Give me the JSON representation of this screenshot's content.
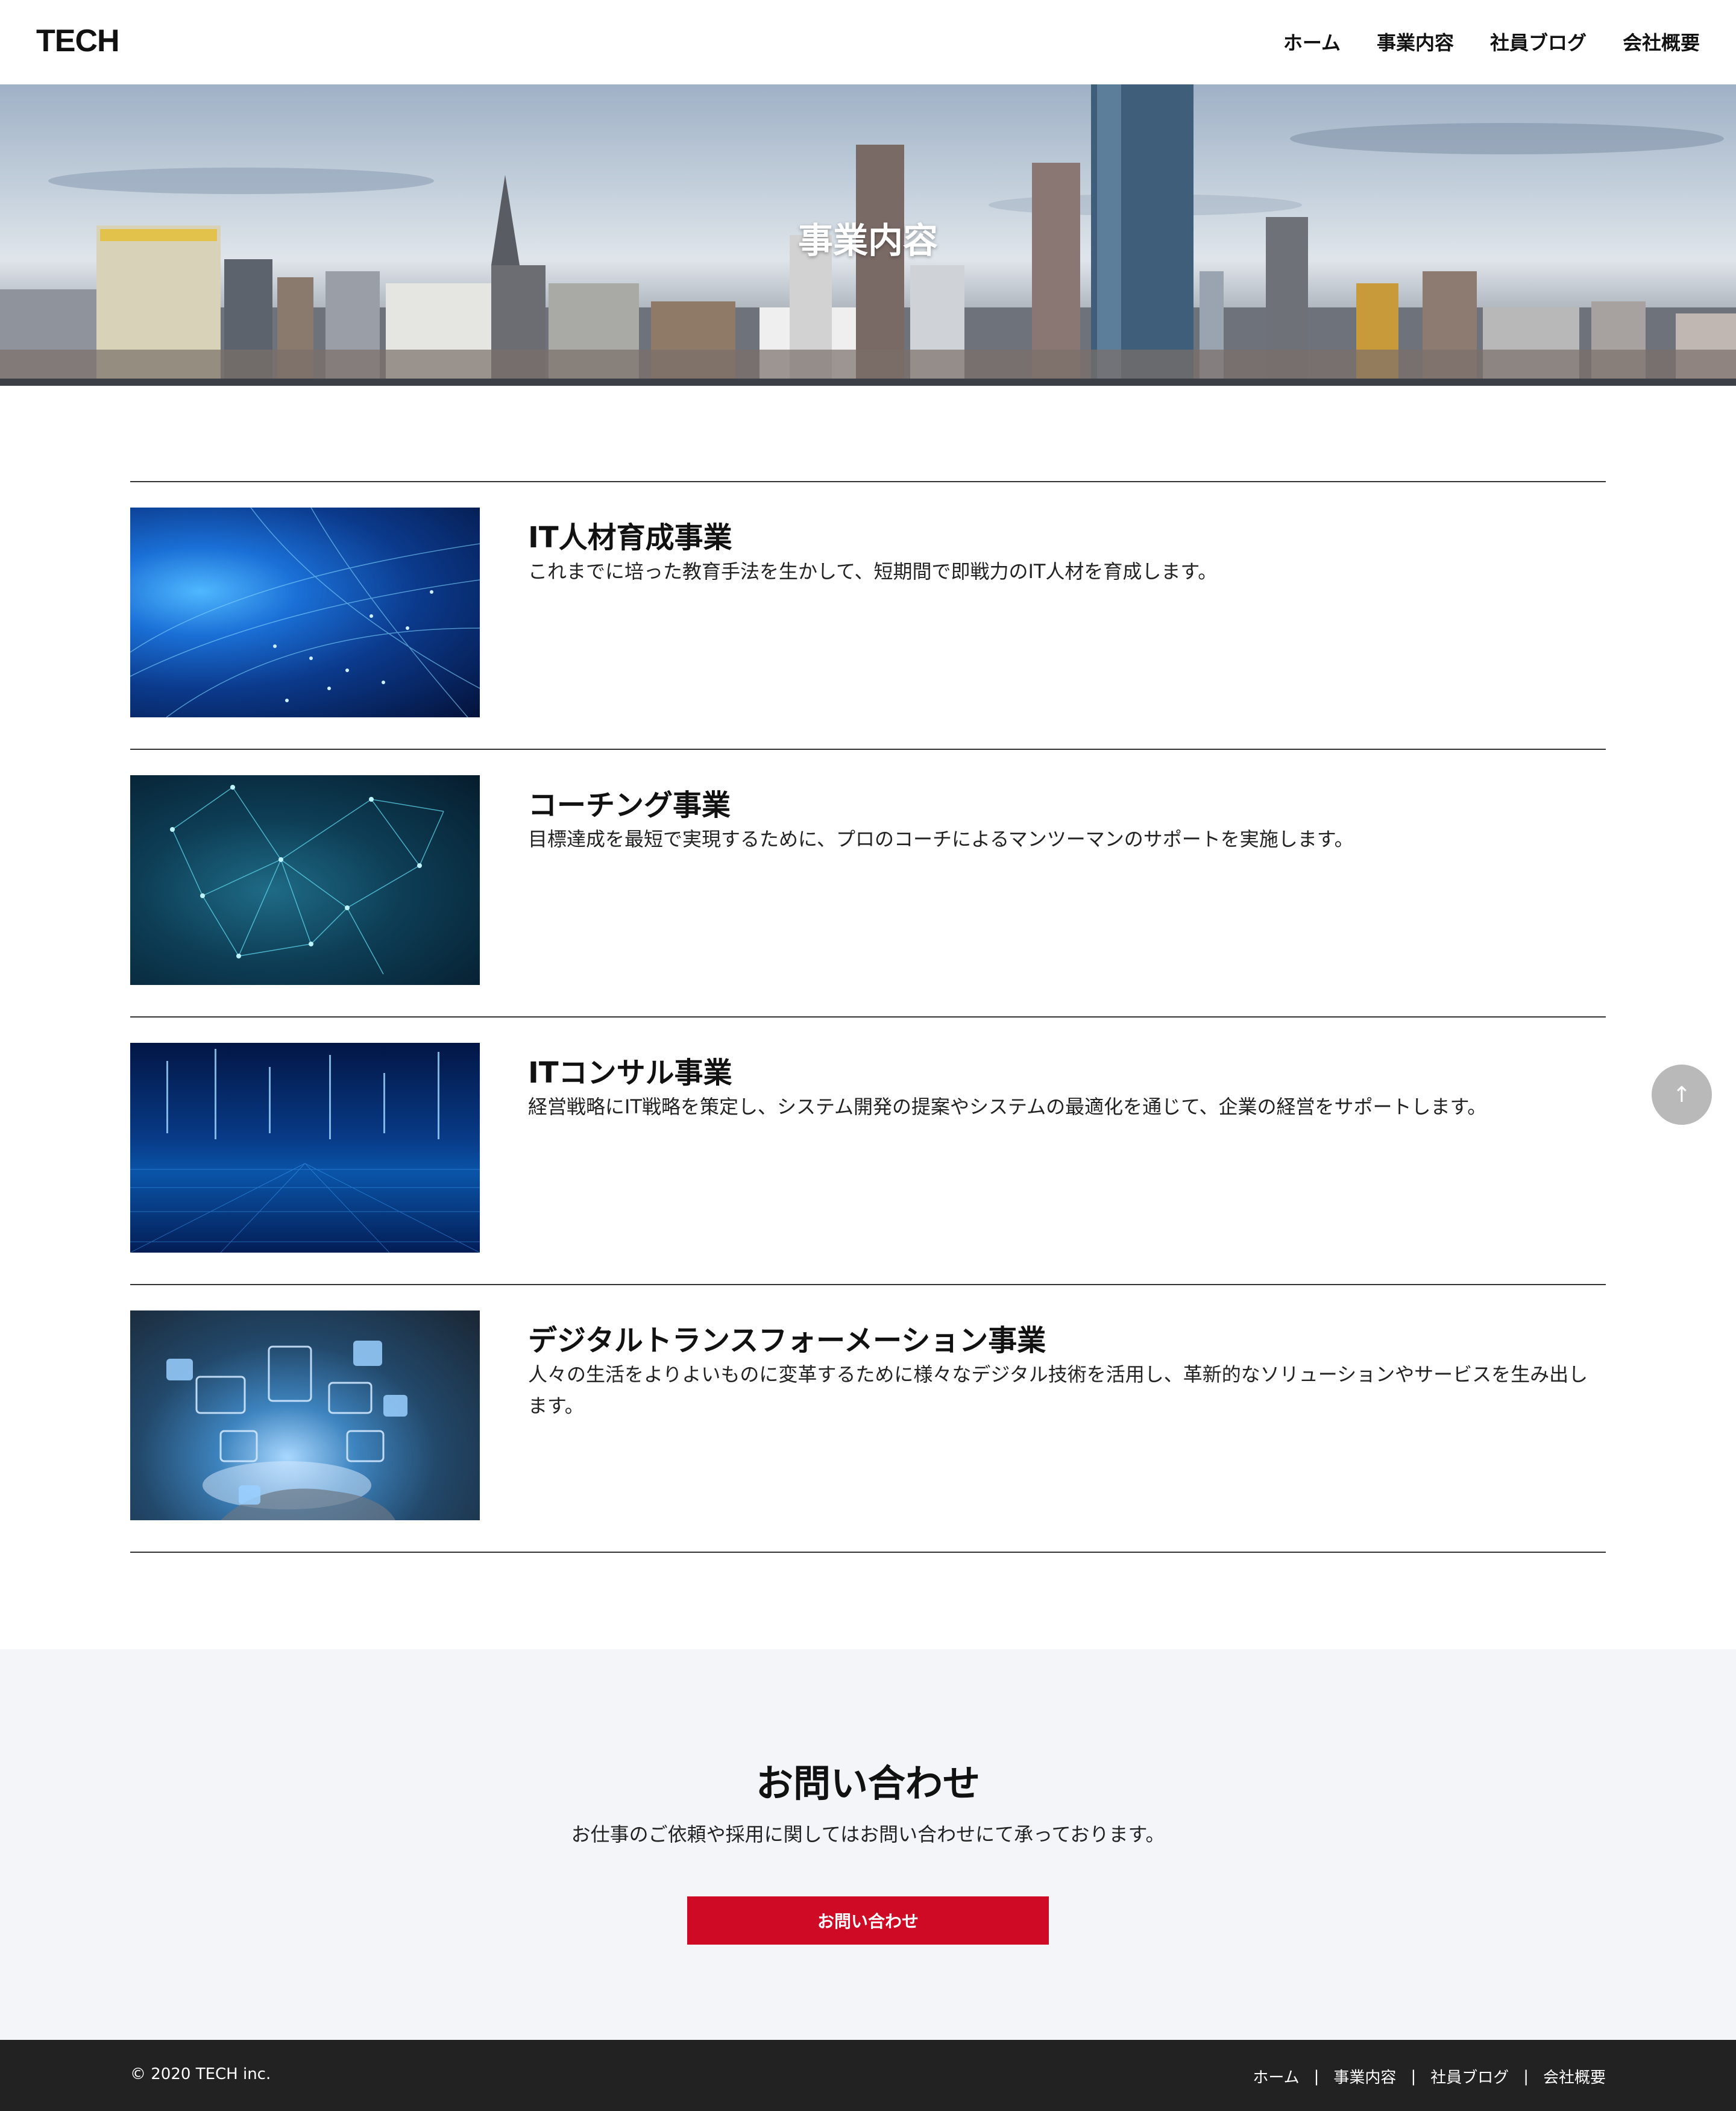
{
  "header": {
    "logo": "TECH",
    "nav": [
      "ホーム",
      "事業内容",
      "社員ブログ",
      "会社概要"
    ]
  },
  "hero": {
    "title": "事業内容"
  },
  "services": [
    {
      "title": "IT人材育成事業",
      "description": "これまでに培った教育手法を生かして、短期間で即戦力のIT人材を育成します。",
      "image_icon": "blue-network-globe-image"
    },
    {
      "title": "コーチング事業",
      "description": "目標達成を最短で実現するために、プロのコーチによるマンツーマンのサポートを実施します。",
      "image_icon": "teal-connected-polygons-image"
    },
    {
      "title": "ITコンサル事業",
      "description": "経営戦略にIT戦略を策定し、システム開発の提案やシステムの最適化を通じて、企業の経営をサポートします。",
      "image_icon": "digital-data-grid-image"
    },
    {
      "title": "デジタルトランスフォーメーション事業",
      "description": "人々の生活をよりよいものに変革するために様々なデジタル技術を活用し、革新的なソリューションやサービスを生み出します。",
      "image_icon": "hand-holding-app-icons-image"
    }
  ],
  "scroll_top": {
    "label": "↑"
  },
  "contact": {
    "title": "お問い合わせ",
    "description": "お仕事のご依頼や採用に関してはお問い合わせにて承っております。",
    "button_label": "お問い合わせ",
    "button_color": "#cf0a25"
  },
  "footer": {
    "copyright": "© 2020 TECH inc.",
    "nav": [
      "ホーム",
      "事業内容",
      "社員ブログ",
      "会社概要"
    ],
    "separator": "|"
  }
}
